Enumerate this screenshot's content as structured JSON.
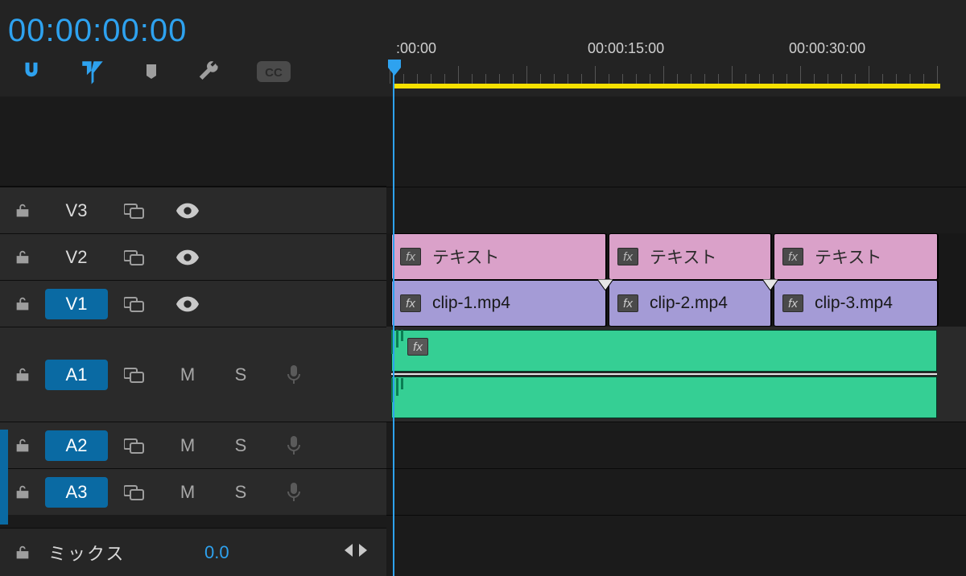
{
  "header": {
    "timecode": "00:00:00:00"
  },
  "ruler": {
    "marks": [
      ":00:00",
      "00:00:15:00",
      "00:00:30:00"
    ]
  },
  "tracks": {
    "video": [
      {
        "id": "V3",
        "active": false,
        "eye": true
      },
      {
        "id": "V2",
        "active": false,
        "eye": true
      },
      {
        "id": "V1",
        "active": true,
        "eye": true
      }
    ],
    "audio": [
      {
        "id": "A1",
        "active": true,
        "mute": "M",
        "solo": "S"
      },
      {
        "id": "A2",
        "active": true,
        "mute": "M",
        "solo": "S"
      },
      {
        "id": "A3",
        "active": true,
        "mute": "M",
        "solo": "S"
      }
    ]
  },
  "mix": {
    "label": "ミックス",
    "value": "0.0"
  },
  "clips": {
    "text_row": [
      {
        "label": "テキスト",
        "start": 0,
        "end": 270
      },
      {
        "label": "テキスト",
        "start": 270,
        "end": 475
      },
      {
        "label": "テキスト",
        "start": 475,
        "end": 682
      }
    ],
    "video_row": [
      {
        "label": "clip-1.mp4",
        "start": 0,
        "end": 270
      },
      {
        "label": "clip-2.mp4",
        "start": 270,
        "end": 475
      },
      {
        "label": "clip-3.mp4",
        "start": 475,
        "end": 682
      }
    ],
    "fx_label": "fx"
  }
}
